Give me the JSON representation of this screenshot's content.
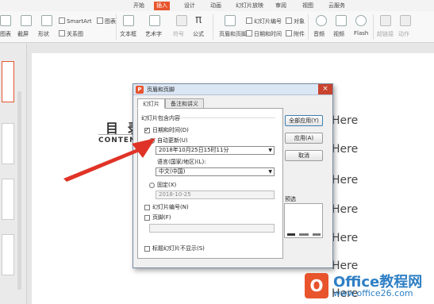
{
  "ribbon": {
    "tabs": [
      "开始",
      "插入",
      "设计",
      "动画",
      "幻灯片放映",
      "审阅",
      "视图",
      "云服务"
    ],
    "active_tab": "插入",
    "items": {
      "shapes_partial": "图表",
      "screenshot": "截屏",
      "shape": "形状",
      "smartart": "SmartArt",
      "chart": "图表",
      "relation": "关系图",
      "textbox": "文本框",
      "wordart": "艺术字",
      "symbol": "符号",
      "formula": "公式",
      "header_footer": "页眉和页脚",
      "slide_number": "幻灯片编号",
      "object": "对象",
      "datetime": "日期和时间",
      "attachment": "附件",
      "audio": "音频",
      "video": "视频",
      "flash": "Flash",
      "hyperlink": "超链接",
      "action": "动作"
    }
  },
  "slide": {
    "title": "目 录",
    "subtitle": "CONTEN",
    "here_items": [
      "Here",
      "Here",
      "Here",
      "Here",
      "Here",
      "Here",
      "Here"
    ]
  },
  "dialog": {
    "title": "页眉和页脚",
    "close": "×",
    "tabs": [
      "幻灯片",
      "备注和讲义"
    ],
    "group_label": "幻灯片包含内容",
    "datetime_label": "日期和时间(D)",
    "datetime_checked": true,
    "auto_update_label": "自动更新(U)",
    "auto_update_value": "2018年10月25日15时11分",
    "language_label": "语言(国家/地区)(L):",
    "language_value": "中文(中国)",
    "fixed_label": "固定(X)",
    "fixed_value": "2018-10-25",
    "slide_number_label": "幻灯片编号(N)",
    "footer_label": "页脚(F)",
    "hide_on_title_label": "标题幻灯片不显示(S)",
    "buttons": {
      "apply_all": "全部应用(Y)",
      "apply": "应用(A)",
      "cancel": "取消"
    },
    "preview_label": "预选"
  },
  "watermark": {
    "logo_char": "O",
    "name": "Office教程网",
    "url": "www.office26.com"
  },
  "colors": {
    "accent": "#e8542c",
    "arrow": "#e03327",
    "watermark_blue": "#2e7fc4"
  }
}
